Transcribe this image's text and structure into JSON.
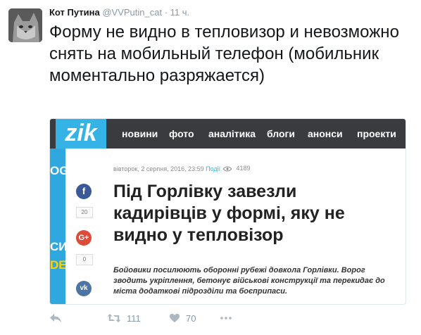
{
  "tweet": {
    "author_name": "Кот Путина",
    "handle": "@VVPutin_cat",
    "separator": "·",
    "time": "11 ч.",
    "text": "Форму не видно в тепловизор и невозможно снять на мобильный телефон (мобильник моментально разряжается)",
    "retweets": "111",
    "likes": "70"
  },
  "card": {
    "logo": "zik",
    "nav": [
      "новини",
      "фото",
      "аналітика",
      "блоги",
      "анонси",
      "проекти"
    ],
    "left_strip": [
      "OG",
      "СИ",
      "DE"
    ],
    "share": {
      "facebook_count": "20",
      "google_count": "0"
    },
    "article": {
      "date": "вівторок, 2 серпня, 2016, 23:59",
      "category": "Події",
      "views": "4189",
      "headline": "Під Горлівку завезли кадирівців у формі, яку не видно у тепловізор",
      "lead": "Бойовики посилюють оборонні рубежі довкола Горлівки. Ворог зводить укріплення, бетонує військові конструкції та перекидає до міста додаткові підрозділи та боєприпаси."
    }
  },
  "colors": {
    "zik_blue": "#35b3e6",
    "nav_bg": "#3a3b3e",
    "facebook": "#3b5998",
    "google": "#dd4b39",
    "vk": "#4c75a3",
    "twitter_gray": "#aab8c2"
  },
  "icons": [
    "reply-icon",
    "retweet-icon",
    "like-icon",
    "more-icon",
    "facebook-icon",
    "google-plus-icon",
    "vk-icon",
    "eye-icon"
  ]
}
